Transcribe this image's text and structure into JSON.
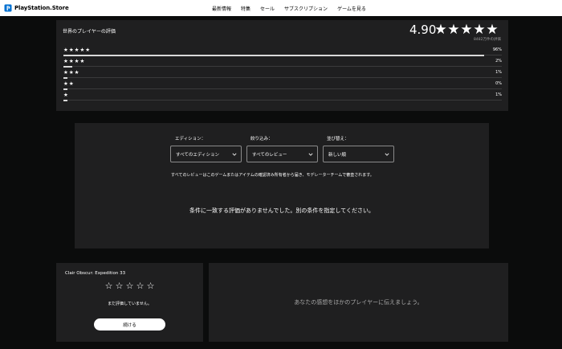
{
  "header": {
    "logo_text": "PlayStation.Store",
    "nav": [
      "最新情報",
      "特集",
      "セール",
      "サブスクリプション",
      "ゲームを見る"
    ]
  },
  "ratings": {
    "title": "世界のプレイヤーの評価",
    "average": "4.90",
    "average_stars": [
      "★",
      "★",
      "★",
      "★",
      "★"
    ],
    "count_text": "8482万件の評価",
    "distribution": [
      {
        "stars": "★★★★★",
        "percent_text": "96%",
        "fraction": 0.96
      },
      {
        "stars": "★★★★",
        "percent_text": "2%",
        "fraction": 0.02
      },
      {
        "stars": "★★★",
        "percent_text": "1%",
        "fraction": 0.01
      },
      {
        "stars": "★★",
        "percent_text": "0%",
        "fraction": 0.0
      },
      {
        "stars": "★",
        "percent_text": "1%",
        "fraction": 0.01
      }
    ]
  },
  "filters": {
    "edition": {
      "label": "エディション：",
      "value": "すべてのエディション"
    },
    "filter": {
      "label": "絞り込み：",
      "value": "すべてのレビュー"
    },
    "sort": {
      "label": "並び替え：",
      "value": "新しい順"
    },
    "note": "すべてのレビューはこのゲームまたはアイテムの確認済み所有者から届き、モデレーターチームで審査されます。",
    "empty_message": "条件に一致する評価がありませんでした。別の条件を指定してください。"
  },
  "game_card": {
    "title": "Clair Obscur: Expedition 33",
    "rating_stars": [
      "☆",
      "☆",
      "☆",
      "☆",
      "☆"
    ],
    "note": "まだ評価していません。",
    "button_label": "続ける"
  },
  "thoughts_card": {
    "text": "あなたの感想をほかのプレイヤーに伝えましょう。"
  },
  "colors": {
    "page_bg": "#0b0c0c",
    "panel_bg": "#1f1f20",
    "header_bg": "#ffffff",
    "bar_fill": "#d9d9d9",
    "bar_track": "#3a3a3b"
  }
}
